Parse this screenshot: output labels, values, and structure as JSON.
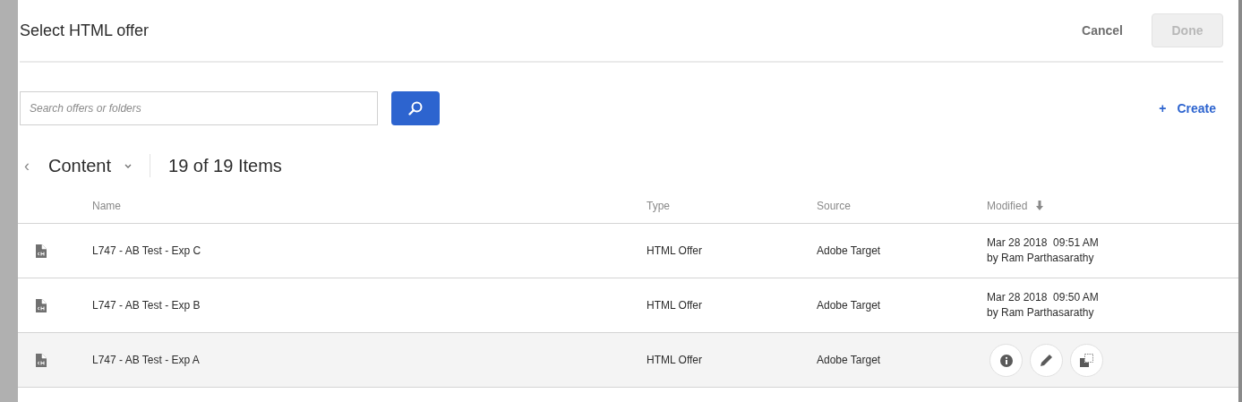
{
  "dialog": {
    "title": "Select HTML offer",
    "cancel": "Cancel",
    "done": {
      "label": "Done",
      "disabled": true
    }
  },
  "search": {
    "placeholder": "Search offers or folders"
  },
  "create": {
    "icon": "+",
    "label": "Create"
  },
  "breadcrumb": {
    "back": "‹",
    "folder": "Content",
    "count": "19 of 19 Items"
  },
  "table": {
    "columns": [
      {
        "label": "Name",
        "sorted": false
      },
      {
        "label": "Type",
        "sorted": false
      },
      {
        "label": "Source",
        "sorted": false
      },
      {
        "label": "Modified",
        "sorted": true
      }
    ],
    "rows": [
      {
        "name": "L747 - AB Test - Exp C",
        "type": "HTML Offer",
        "source": "Adobe Target",
        "modified": "Mar 28 2018  09:51 AM",
        "modified_by": "by Ram Parthasarathy",
        "hovered": false
      },
      {
        "name": "L747 - AB Test - Exp B",
        "type": "HTML Offer",
        "source": "Adobe Target",
        "modified": "Mar 28 2018  09:50 AM",
        "modified_by": "by Ram Parthasarathy",
        "hovered": false
      },
      {
        "name": "L747 - AB Test - Exp A",
        "type": "HTML Offer",
        "source": "Adobe Target",
        "hovered": true
      }
    ]
  }
}
